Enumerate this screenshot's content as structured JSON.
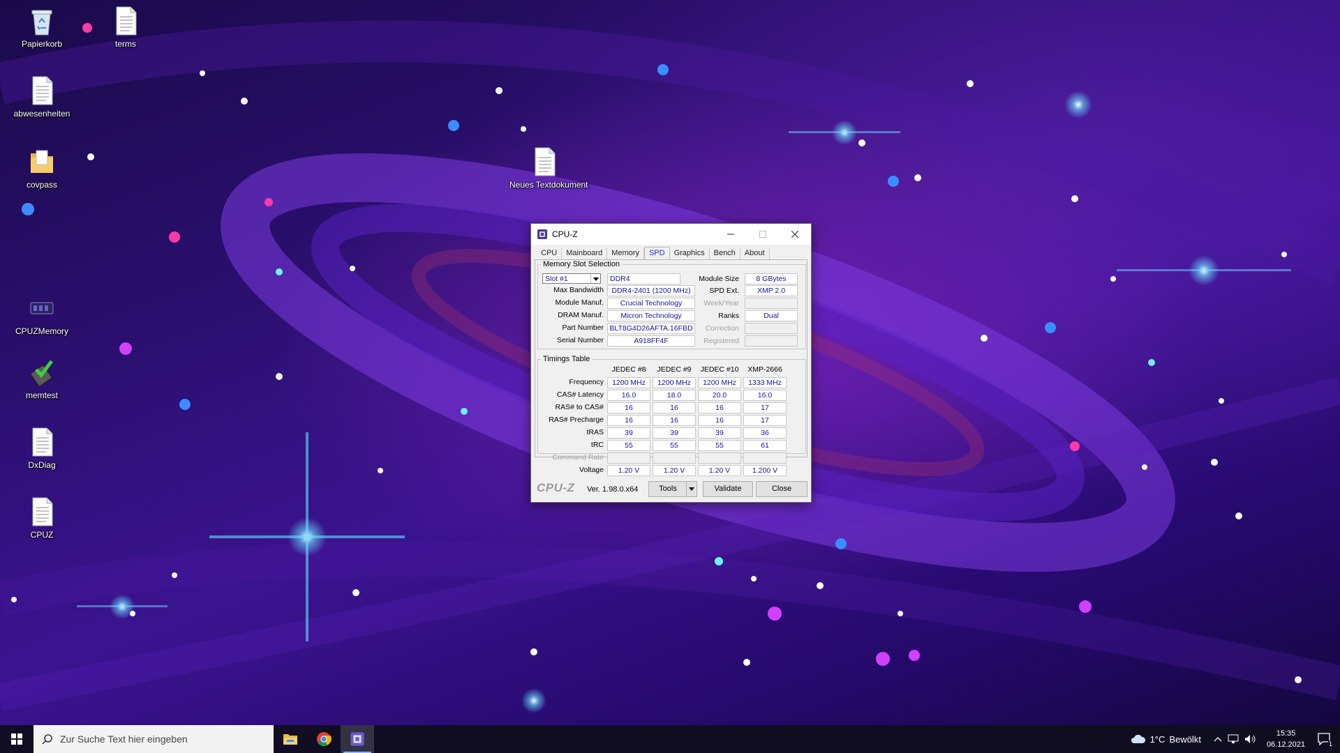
{
  "desktop": {
    "icons": [
      {
        "label": "Papierkorb",
        "icon": "recycle-bin-icon"
      },
      {
        "label": "terms",
        "icon": "text-file-icon"
      },
      {
        "label": "abwesenheiten",
        "icon": "text-file-icon"
      },
      {
        "label": "covpass",
        "icon": "folder-icon"
      },
      {
        "label": "Neues Textdokument",
        "icon": "text-file-icon"
      },
      {
        "label": "CPUZMemory",
        "icon": "cpuz-memory-icon"
      },
      {
        "label": "memtest",
        "icon": "memtest-icon"
      },
      {
        "label": "DxDiag",
        "icon": "text-file-icon"
      },
      {
        "label": "CPUZ",
        "icon": "text-file-icon"
      }
    ]
  },
  "window": {
    "title": "CPU-Z",
    "tabs": [
      "CPU",
      "Mainboard",
      "Memory",
      "SPD",
      "Graphics",
      "Bench",
      "About"
    ],
    "active_tab": "SPD",
    "slot_section": {
      "legend": "Memory Slot Selection",
      "slot_selected": "Slot #1",
      "type": "DDR4",
      "labels": {
        "max_bandwidth": "Max Bandwidth",
        "module_manuf": "Module Manuf.",
        "dram_manuf": "DRAM Manuf.",
        "part_number": "Part Number",
        "serial_number": "Serial Number",
        "module_size": "Module Size",
        "spd_ext": "SPD Ext.",
        "week_year": "Week/Year",
        "ranks": "Ranks",
        "correction": "Correction",
        "registered": "Registered"
      },
      "values": {
        "max_bandwidth": "DDR4-2401 (1200 MHz)",
        "module_manuf": "Crucial Technology",
        "dram_manuf": "Micron Technology",
        "part_number": "BLT8G4D26AFTA.16FBD",
        "serial_number": "A918FF4F",
        "module_size": "8 GBytes",
        "spd_ext": "XMP 2.0",
        "week_year": "",
        "ranks": "Dual",
        "correction": "",
        "registered": ""
      }
    },
    "timings": {
      "legend": "Timings Table",
      "columns": [
        "JEDEC #8",
        "JEDEC #9",
        "JEDEC #10",
        "XMP-2666"
      ],
      "rows": [
        {
          "label": "Frequency",
          "values": [
            "1200 MHz",
            "1200 MHz",
            "1200 MHz",
            "1333 MHz"
          ],
          "disabled": false
        },
        {
          "label": "CAS# Latency",
          "values": [
            "16.0",
            "18.0",
            "20.0",
            "16.0"
          ],
          "disabled": false
        },
        {
          "label": "RAS# to CAS#",
          "values": [
            "16",
            "16",
            "16",
            "17"
          ],
          "disabled": false
        },
        {
          "label": "RAS# Precharge",
          "values": [
            "16",
            "16",
            "16",
            "17"
          ],
          "disabled": false
        },
        {
          "label": "tRAS",
          "values": [
            "39",
            "39",
            "39",
            "36"
          ],
          "disabled": false
        },
        {
          "label": "tRC",
          "values": [
            "55",
            "55",
            "55",
            "61"
          ],
          "disabled": false
        },
        {
          "label": "Command Rate",
          "values": [
            "",
            "",
            "",
            ""
          ],
          "disabled": true
        },
        {
          "label": "Voltage",
          "values": [
            "1.20 V",
            "1.20 V",
            "1.20 V",
            "1.200 V"
          ],
          "disabled": false
        }
      ]
    },
    "footer": {
      "logo": "CPU-Z",
      "version": "Ver. 1.98.0.x64",
      "tools_label": "Tools",
      "validate_label": "Validate",
      "close_label": "Close"
    }
  },
  "taskbar": {
    "search_placeholder": "Zur Suche Text hier eingeben",
    "weather_temp": "1°C",
    "weather_text": "Bewölkt",
    "time": "15:35",
    "date": "06.12.2021",
    "notification_count": "1",
    "colors": {
      "accent": "#8ab4ff",
      "taskbar": "#100e1e"
    }
  }
}
